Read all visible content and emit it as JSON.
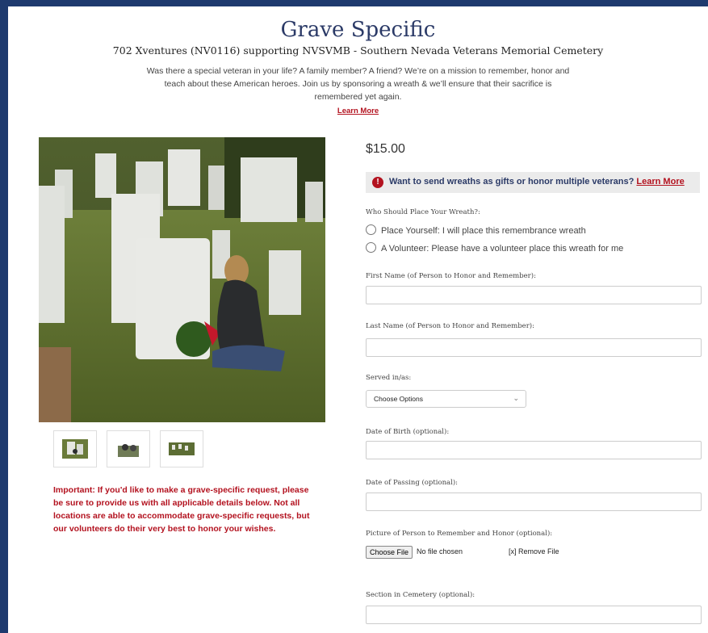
{
  "header": {
    "title": "Grave Specific",
    "subtitle": "702 Xventures (NV0116) supporting NVSVMB - Southern Nevada Veterans Memorial Cemetery",
    "intro": "Was there a special veteran in your life? A family member? A friend? We’re on a mission to remember, honor and teach about these American heroes. Join us by sponsoring a wreath & we’ll ensure that their sacrifice is remembered yet again.",
    "learn_more": "Learn More"
  },
  "left": {
    "important": "Important: If you'd like to make a grave-specific request, please be sure to provide us with all applicable details below. Not all locations are able to accommodate grave-specific requests, but our volunteers do their very best to honor your wishes."
  },
  "product": {
    "price": "$15.00",
    "notice_text": "Want to send wreaths as gifts or honor multiple veterans?",
    "notice_link": "Learn More",
    "notice_icon": "info-icon"
  },
  "form": {
    "who_label": "Who Should Place Your Wreath?:",
    "option1": "Place Yourself: I will place this remembrance wreath",
    "option2": "A Volunteer: Please have a volunteer place this wreath for me",
    "first_name_label": "First Name (of Person to Honor and Remember):",
    "last_name_label": "Last Name (of Person to Honor and Remember):",
    "served_label": "Served in/as:",
    "served_value": "Choose Options",
    "dob_label": "Date of Birth (optional):",
    "dop_label": "Date of Passing (optional):",
    "picture_label": "Picture of Person to Remember and Honor (optional):",
    "choose_file": "Choose File",
    "no_file": "No file chosen",
    "remove_file": "[x] Remove File",
    "section_label": "Section in Cemetery (optional):"
  },
  "colors": {
    "brand_navy": "#2b3a67",
    "accent_red": "#b3121f",
    "frame_blue": "#1e3a6e"
  }
}
